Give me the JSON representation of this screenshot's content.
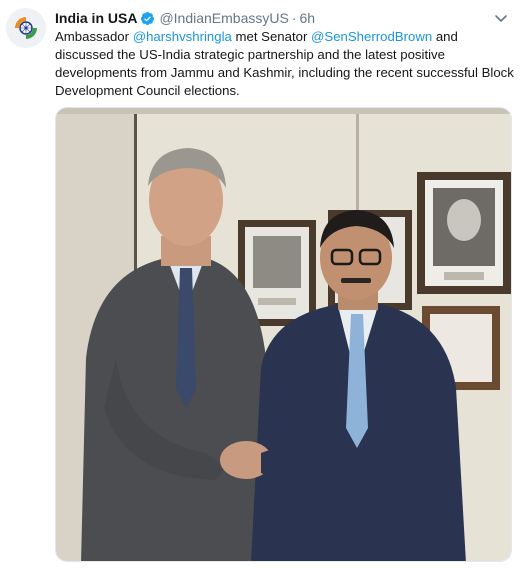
{
  "tweet": {
    "display_name": "India in USA",
    "handle": "@IndianEmbassyUS",
    "separator": "·",
    "time": "6h",
    "text": {
      "t1": "Ambassador ",
      "mention1": "@harshvshringla",
      "t2": " met Senator ",
      "mention2": "@SenSherrodBrown",
      "t3": " and discussed the US-India strategic partnership and the latest positive developments from Jammu and Kashmir, including the recent successful Block Development Council elections."
    },
    "media": {
      "icon": "photo"
    }
  },
  "colors": {
    "link": "#1b95e0",
    "secondary_text": "#657786",
    "verified": "#1da1f2"
  }
}
